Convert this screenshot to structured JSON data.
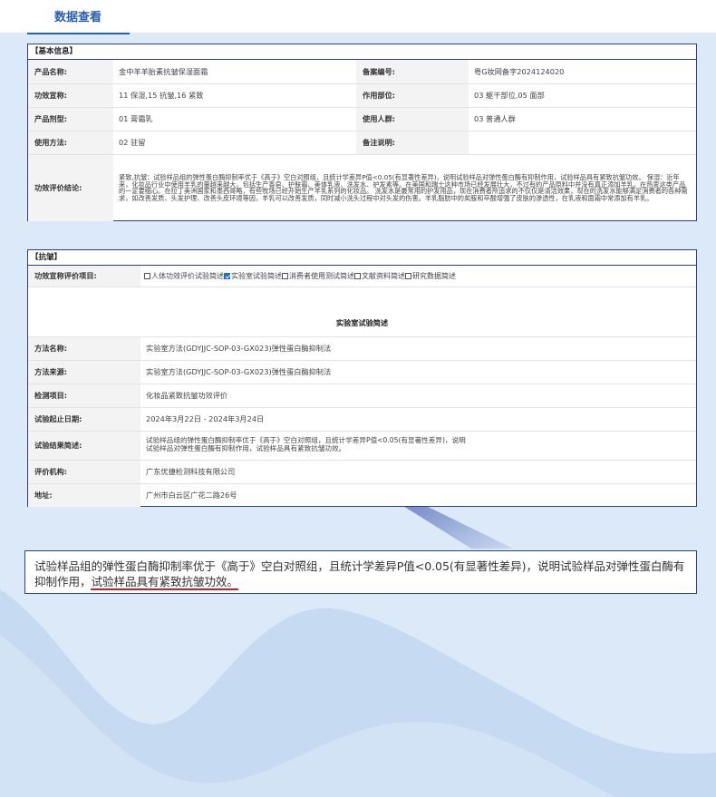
{
  "colors": {
    "accent": "#2563b0",
    "frame": "#2c3e8f",
    "highlight_underline": "#d42222",
    "label_bg": "#f3f3f3",
    "background": "#dce9f8"
  },
  "header": {
    "tab_label": "数据查看"
  },
  "basic_info": {
    "section_title": "【基本信息】",
    "product_name_label": "产品名称:",
    "product_name": "金中羊羊胎素抗皱保湿面霜",
    "record_no_label": "备案编号:",
    "record_no": "粤G妆网备字2024124020",
    "efficacy_label": "功效宣称:",
    "efficacy": "11 保湿,15 抗皱,16 紧致",
    "area_label": "作用部位:",
    "area": "03 躯干部位,05 面部",
    "form_label": "产品剂型:",
    "form": "01 膏霜乳",
    "users_label": "使用人群:",
    "users": "03 普通人群",
    "usage_label": "使用方法:",
    "usage": "02 驻留",
    "notes_label": "备注说明:",
    "notes": "",
    "eval_label": "功效评价结论:",
    "eval_text": "紧致,抗皱：试验样品组的弹性蛋白酶抑制率优于《高于》空白对照组，且统计学差异P值<0.05(有显著性差异)，说明试验样品对弹性蛋白酶有抑制作用，试验样品具有紧致抗皱功效。 保湿：近年来，化妆品行业中使用羊乳的量越来越大，包括生产香皂、护肤霜、美体乳液、洗发水、护发素等。在美国和瑞士这种市场已经发展壮大，不过有的产品原料中并没有真正添加羊乳。在热衷这类产品的一定要细心。在拉丁美洲国家和墨西哥略，有些牧场已经开始生产羊乳系列的化妆品。 洗发水是最常用的护发用品，现在消费者所追求的不仅仅是清洁效果，现在的洗发水能够满足消费者的各种需求，如改善发质、头发护理、改善头皮环境等因，羊乳可以改善发质，同时减小洗头过程中对头发的伤害。羊乳脂肪中的矣胺和卒酸增强了皮肤的渗透性，在乳液和面霜中常添加有羊乳。"
  },
  "anti_wrinkle": {
    "section_title": "【抗皱】",
    "eval_items_label": "功效宣称评价项目:",
    "checkboxes": [
      {
        "label": "人体功效评价试验简述",
        "checked": false
      },
      {
        "label": "实验室试验简述",
        "checked": true
      },
      {
        "label": "消费者使用测试简述",
        "checked": false
      },
      {
        "label": "文献资料简述",
        "checked": false
      },
      {
        "label": "研究数据简述",
        "checked": false
      }
    ],
    "subsection_title": "实验室试验简述",
    "method_name_label": "方法名称:",
    "method_name": "实验室方法(GDYJJC-SOP-03-GX023)弹性蛋白酶抑制法",
    "method_source_label": "方法来源:",
    "method_source": "实验室方法(GDYJJC-SOP-03-GX023)弹性蛋白酶抑制法",
    "test_item_label": "检测项目:",
    "test_item": "化妆品紧致抗皱功效评价",
    "date_label": "试验起止日期:",
    "date": "2024年3月22日 - 2024年3月24日",
    "result_label": "试验结果简述:",
    "result": "试验样品组的弹性蛋白酶抑制率优于《高于》空白对照组，且统计学差异P值<0.05(有显著性差异)，说明试验样品对弹性蛋白酶有抑制作用，试验样品具有紧致抗皱功效。",
    "agency_label": "评价机构:",
    "agency": "广东优捷检测科技有限公司",
    "address_label": "地址:",
    "address": "广州市白云区广花二路26号"
  },
  "callout": {
    "text": "试验样品组的弹性蛋白酶抑制率优于《高于》空白对照组，且统计学差异P值<0.05(有显著性差异)，说明试验样品对弹性蛋白酶有抑制作用，",
    "highlight": "试验样品具有紧致抗皱功效。"
  }
}
